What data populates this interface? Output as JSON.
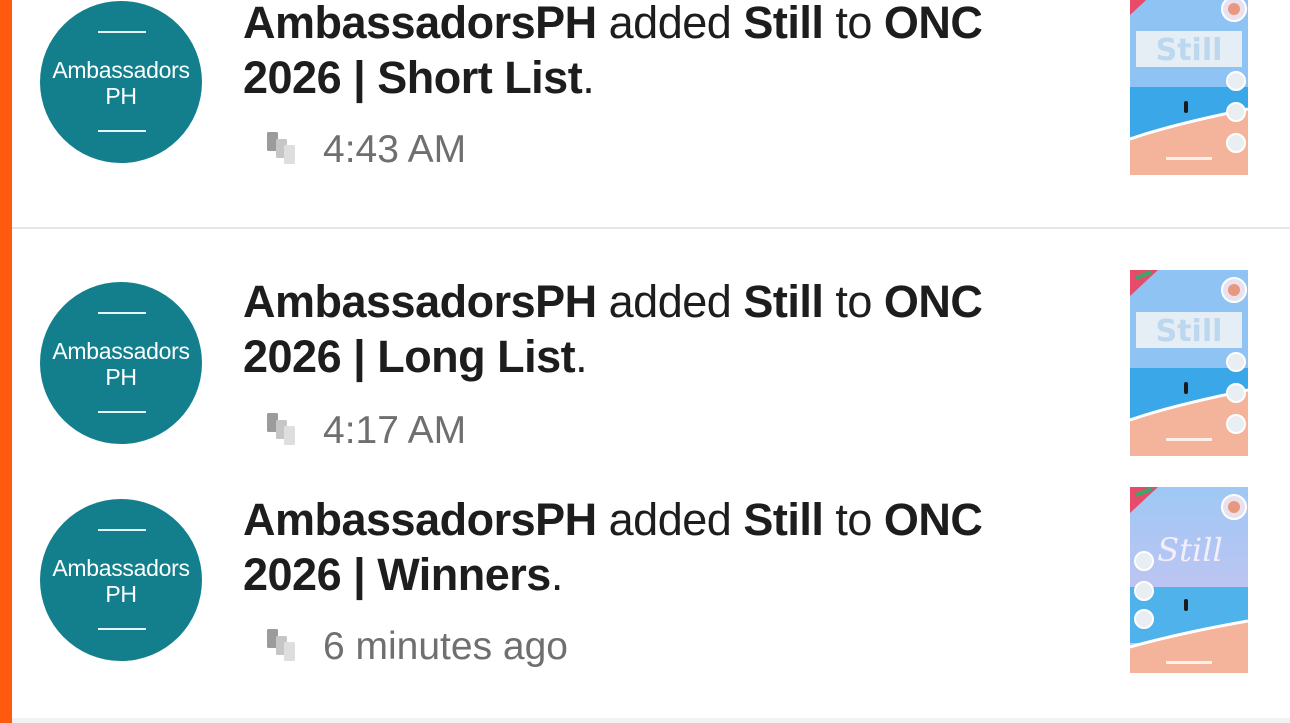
{
  "notifications": [
    {
      "actor": "AmbassadorsPH",
      "verb": "added",
      "book": "Still",
      "preposition": "to",
      "list_line1": "ONC",
      "list_line2": "2026 | Short List",
      "period": ".",
      "time": "4:43 AM",
      "avatar_text_1": "Ambassadors",
      "avatar_text_2": "PH"
    },
    {
      "actor": "AmbassadorsPH",
      "verb": "added",
      "book": "Still",
      "preposition": "to",
      "list_line1": "ONC",
      "list_line2": "2026 | Long List",
      "period": ".",
      "time": "4:17 AM",
      "avatar_text_1": "Ambassadors",
      "avatar_text_2": "PH"
    },
    {
      "actor": "AmbassadorsPH",
      "verb": "added",
      "book": "Still",
      "preposition": "to",
      "list_line1": "ONC",
      "list_line2": "2026 | Winners",
      "period": ".",
      "time": "6 minutes ago",
      "avatar_text_1": "Ambassadors",
      "avatar_text_2": "PH"
    }
  ],
  "colors": {
    "accent": "#ff5a10",
    "avatar_bg": "#137f8d",
    "text": "#1d1d1d",
    "meta": "#6f6f6f"
  },
  "icons": {
    "meta_icon": "copy-stack-icon"
  }
}
